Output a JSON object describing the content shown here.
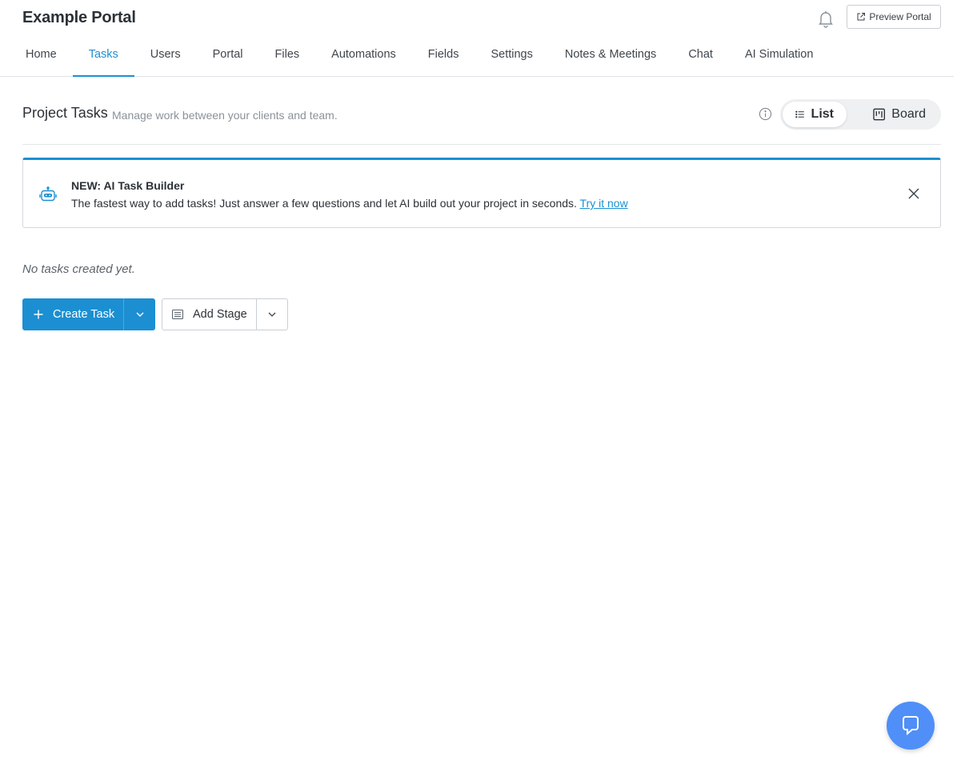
{
  "app": {
    "title": "Example Portal"
  },
  "header": {
    "preview_label": "Preview Portal"
  },
  "tabs": [
    {
      "label": "Home",
      "active": false
    },
    {
      "label": "Tasks",
      "active": true
    },
    {
      "label": "Users",
      "active": false
    },
    {
      "label": "Portal",
      "active": false
    },
    {
      "label": "Files",
      "active": false
    },
    {
      "label": "Automations",
      "active": false
    },
    {
      "label": "Fields",
      "active": false
    },
    {
      "label": "Settings",
      "active": false
    },
    {
      "label": "Notes & Meetings",
      "active": false
    },
    {
      "label": "Chat",
      "active": false
    },
    {
      "label": "AI Simulation",
      "active": false
    }
  ],
  "section": {
    "title": "Project Tasks",
    "subtitle": "Manage work between your clients and team."
  },
  "view_toggle": {
    "list_label": "List",
    "board_label": "Board",
    "selected": "List"
  },
  "banner": {
    "title": "NEW: AI Task Builder",
    "text": "The fastest way to add tasks! Just answer a few questions and let AI build out your project in seconds.",
    "link": "Try it now"
  },
  "empty_state": "No tasks created yet.",
  "actions": {
    "create_task": "Create Task",
    "add_stage": "Add Stage"
  },
  "colors": {
    "accent": "#1b8fd2",
    "chat": "#4f8ff7"
  }
}
